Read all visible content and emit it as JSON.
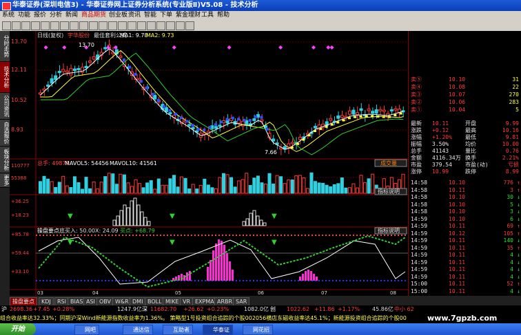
{
  "window": {
    "title": "华泰证券(深圳电信3) - 华泰证券网上证券分析系统(专业版Ⅱ)V5.08 - 技术分析"
  },
  "menu": [
    "系统",
    "功能",
    "报价",
    "分析",
    "新闻",
    "商品期货",
    "创业板",
    "资讯",
    "智能",
    "下单",
    "紫金理财",
    "工具",
    "帮助"
  ],
  "left_tabs": [
    "分时走势",
    "技术分析",
    "公司资讯",
    "自选报价",
    "板块分析",
    "更多"
  ],
  "chart": {
    "main_header": {
      "period": "日线(复权)",
      "stock": "宇华股份",
      "formula": "最佳套利公式",
      "ma1": "MA1: 9.78",
      "ma2": "MA2: 9.73"
    },
    "price_ticks": [
      "13.70",
      "12.11",
      "10.52",
      "8.93"
    ],
    "high_label": "13.70",
    "low_label": "7.66",
    "vol_header": {
      "label": "总手: 49879",
      "v5": "MAVOL5: 54456",
      "v10": "MAVOL10: 41561"
    },
    "vol_ticks": [
      "110777",
      "55388"
    ],
    "vol_button": "成交量",
    "ind1_button": "指标说明",
    "ind1_ticks": [
      "+36.25",
      "+18.23"
    ],
    "ind2_header": {
      "name": "操盘要点",
      "v1": "底买入: 50.00",
      "v2": "X: 24.09",
      "v3": "买点: +68.79"
    },
    "ind2_button": "指标说明",
    "ind2_ticks": [
      "+85.78",
      "+59.44",
      "+33.10"
    ],
    "month_ticks": [
      "03",
      "04",
      "05",
      "06",
      "07",
      "08",
      "09"
    ]
  },
  "quote_panel": {
    "asks": [
      [
        "卖⑤",
        "10.10",
        "31"
      ],
      [
        "卖④",
        "10.08",
        "22"
      ],
      [
        "卖③",
        "10.07",
        "270"
      ],
      [
        "卖②",
        "10.06",
        "283"
      ],
      [
        "卖①",
        "10.04",
        "5"
      ]
    ],
    "bids_title": "买①",
    "stats": [
      [
        "最新",
        "10.11",
        "开盘",
        "9.99"
      ],
      [
        "涨跌",
        "+0.12",
        "最高",
        "10.16"
      ],
      [
        "涨幅",
        "+1.20%",
        "最低",
        "9.81"
      ],
      [
        "振幅",
        "3.50%",
        "均价",
        "10.00"
      ],
      [
        "总手",
        "41143",
        "量比",
        "0.76"
      ],
      [
        "金额",
        "4116.34万",
        "换手",
        "2.21%"
      ],
      [
        "市盈",
        "379.54",
        "市盈(动)",
        "亏损"
      ],
      [
        "涨停",
        "10.99",
        "跌停",
        "8.99"
      ]
    ],
    "ticks": [
      [
        "14:58",
        "10.10",
        "776",
        "up"
      ],
      [
        "14:58",
        "10.11",
        "3",
        "up"
      ],
      [
        "14:58",
        "10.10",
        "30",
        "dn"
      ],
      [
        "14:58",
        "10.10",
        "5",
        "dn"
      ],
      [
        "14:58",
        "10.10",
        "3",
        "dn"
      ],
      [
        "14:59",
        "10.10",
        "6",
        "dn"
      ],
      [
        "14:59",
        "10.11",
        "69",
        "up"
      ],
      [
        "14:59",
        "10.12",
        "105",
        "up"
      ],
      [
        "14:59",
        "10.11",
        "140",
        "dn"
      ],
      [
        "14:59",
        "10.11",
        "35",
        "up"
      ],
      [
        "14:59",
        "10.11",
        "4",
        "dn"
      ],
      [
        "14:59",
        "10.11",
        "4",
        "dn"
      ],
      [
        "14:59",
        "10.11",
        "4",
        "dn"
      ],
      [
        "14:59",
        "10.11",
        "4",
        "dn"
      ],
      [
        "15:00",
        "10.11",
        "52",
        "up"
      ],
      [
        "15:00",
        "10.11",
        "4",
        "dn"
      ]
    ]
  },
  "bottom_tabs": [
    "操盘要点",
    "KDJ",
    "RSI",
    "BIAS",
    "ASI",
    "OBV",
    "W&R",
    "DMI",
    "BOLL",
    "MIKE",
    "VR",
    "EXPMA",
    "ARBR",
    "SAR"
  ],
  "index_bar": {
    "sh_label": "沪",
    "sh": "2698.36",
    "sh_chg": "+7.45",
    "sh_pct": "+0.28%",
    "sh_amt": "1247.9亿",
    "sz_label": "深",
    "sz": "11682.70",
    "sz_chg": "+26.62",
    "sz_pct": "+0.23%",
    "sz_amt": "1082.0亿",
    "cy_label": "创",
    "cy": "1022.62",
    "cy_chg": "+11.86",
    "cy_pct": "+1.17%",
    "cy_amt": "45.86亿",
    "extra": "中小 62"
  },
  "ticker": "组合收益率达32.33%；同期沪深Wind新能源指数收益率为1.36%。 策略型1号投资组合追踪的个股002056横店东磁收益率达45.1%；新能源投资组合追踪的个股00",
  "taskbar": {
    "start": "开始",
    "tasks": [
      "网吧",
      "通达信",
      "互助者",
      "华泰证",
      "网花招"
    ]
  },
  "watermark": "www.7gpzb.com",
  "colors": {
    "up": "#ff3b3b",
    "down": "#29e329",
    "ma1": "#ffffff",
    "ma2": "#ffff40",
    "ind_magenta": "#ff2bd6"
  }
}
